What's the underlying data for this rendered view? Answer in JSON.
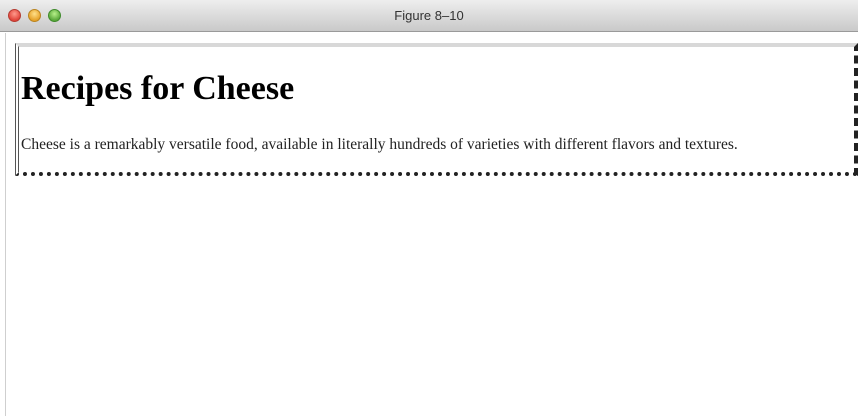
{
  "window": {
    "title": "Figure 8–10"
  },
  "page": {
    "heading": "Recipes for Cheese",
    "paragraph": "Cheese is a remarkably versatile food, available in literally hundreds of varieties with different flavors and textures."
  },
  "colors": {
    "close_button": "#e0443a",
    "minimize_button": "#e6a22a",
    "zoom_button": "#5aa83a"
  }
}
